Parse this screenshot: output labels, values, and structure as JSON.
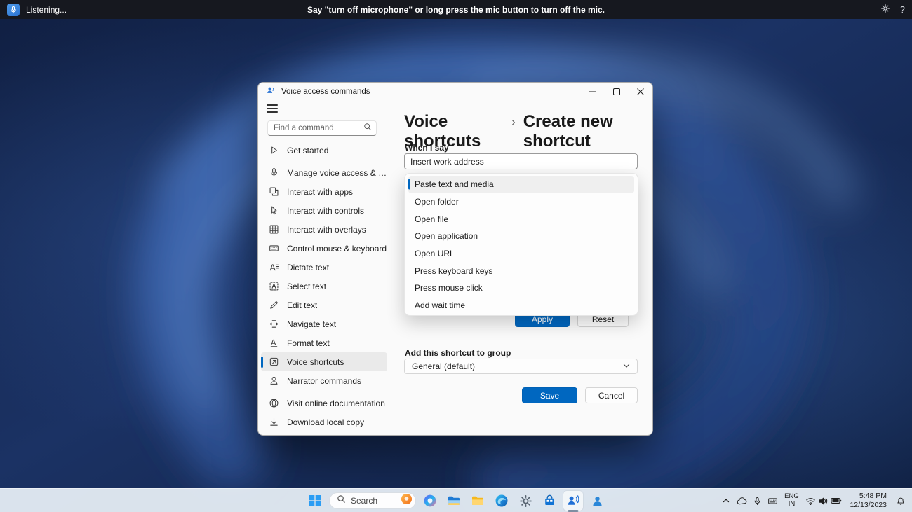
{
  "voice_bar": {
    "status": "Listening...",
    "message": "Say \"turn off microphone\" or long press the mic button to turn off the mic."
  },
  "app_window": {
    "title": "Voice access commands",
    "search": {
      "placeholder": "Find a command"
    },
    "sidebar": {
      "items": [
        {
          "label": "Get started",
          "icon": "play",
          "selected": false
        },
        {
          "label": "Manage voice access & mic",
          "icon": "mic",
          "selected": false
        },
        {
          "label": "Interact with apps",
          "icon": "apps",
          "selected": false
        },
        {
          "label": "Interact with controls",
          "icon": "cursor",
          "selected": false
        },
        {
          "label": "Interact with overlays",
          "icon": "overlay",
          "selected": false
        },
        {
          "label": "Control mouse & keyboard",
          "icon": "keyboard",
          "selected": false
        },
        {
          "label": "Dictate text",
          "icon": "dictate",
          "selected": false
        },
        {
          "label": "Select text",
          "icon": "select",
          "selected": false
        },
        {
          "label": "Edit text",
          "icon": "edit",
          "selected": false
        },
        {
          "label": "Navigate text",
          "icon": "navigate",
          "selected": false
        },
        {
          "label": "Format text",
          "icon": "format",
          "selected": false
        },
        {
          "label": "Voice shortcuts",
          "icon": "shortcut",
          "selected": true
        },
        {
          "label": "Narrator commands",
          "icon": "narrator",
          "selected": false
        }
      ],
      "footer": [
        {
          "label": "Visit online documentation",
          "icon": "globe"
        },
        {
          "label": "Download local copy",
          "icon": "download"
        }
      ]
    },
    "breadcrumb": {
      "parent": "Voice shortcuts",
      "separator": "›",
      "current": "Create new shortcut"
    },
    "form": {
      "trigger_label": "When I say",
      "trigger_value": "Insert work address",
      "action_menu": {
        "items": [
          "Paste text and media",
          "Open folder",
          "Open file",
          "Open application",
          "Open URL",
          "Press keyboard keys",
          "Press mouse click",
          "Add wait time"
        ],
        "selected_index": 0
      },
      "apply": "Apply",
      "reset": "Reset",
      "group_label": "Add this shortcut to group",
      "group_value": "General (default)",
      "save": "Save",
      "cancel": "Cancel"
    }
  },
  "taskbar": {
    "search_label": "Search",
    "apps": [
      {
        "name": "copilot",
        "active": false
      },
      {
        "name": "file-explorer",
        "active": false
      },
      {
        "name": "folder",
        "active": false
      },
      {
        "name": "edge",
        "active": false
      },
      {
        "name": "settings",
        "active": false
      },
      {
        "name": "store",
        "active": false
      },
      {
        "name": "voice-access",
        "active": true
      },
      {
        "name": "people",
        "active": false
      }
    ],
    "tray": {
      "icons_left": [
        "chevron-up",
        "cloud",
        "mic",
        "keyboard"
      ],
      "icons_status": [
        "wifi",
        "volume",
        "battery"
      ],
      "language_line1": "ENG",
      "language_line2": "IN",
      "time": "5:48 PM",
      "date": "12/13/2023"
    }
  },
  "colors": {
    "accent": "#0067c0",
    "voicebar_bg": "#16181f",
    "taskbar_bg": "#eaf1f8"
  }
}
